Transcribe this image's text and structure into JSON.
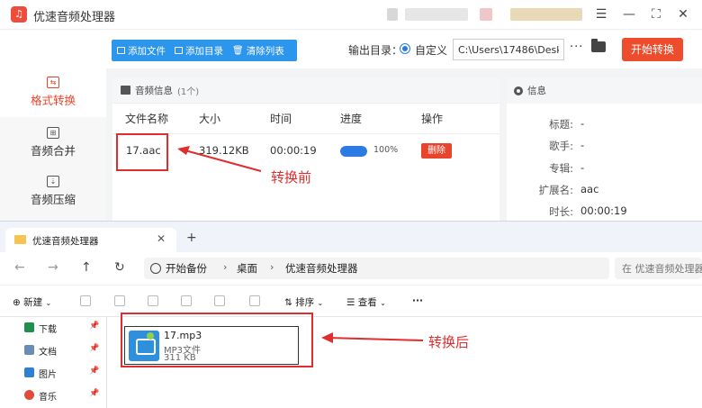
{
  "app": {
    "title": "优速音频处理器",
    "toolbar": {
      "add_file": "添加文件",
      "add_folder": "添加目录",
      "clear_list": "清除列表",
      "output_label": "输出目录：",
      "custom_label": "自定义",
      "output_path": "C:\\Users\\17486\\Deskto",
      "more": "···",
      "start": "开始转换"
    },
    "sidebar": [
      {
        "label": "格式转换",
        "icon": "convert-icon",
        "active": true
      },
      {
        "label": "音频合并",
        "icon": "merge-icon",
        "active": false
      },
      {
        "label": "音频压缩",
        "icon": "compress-icon",
        "active": false
      }
    ],
    "audio_panel": {
      "title": "音频信息",
      "count": "(1个)",
      "columns": {
        "name": "文件名称",
        "size": "大小",
        "time": "时间",
        "progress": "进度",
        "action": "操作"
      },
      "rows": [
        {
          "name": "17.aac",
          "size": "319.12KB",
          "time": "00:00:19",
          "progress": 1.0,
          "progress_text": "100%",
          "action": "删除"
        }
      ]
    },
    "info_panel": {
      "title": "信息",
      "rows": [
        {
          "key": "标题:",
          "value": "-"
        },
        {
          "key": "歌手:",
          "value": "-"
        },
        {
          "key": "专辑:",
          "value": "-"
        },
        {
          "key": "扩展名:",
          "value": "aac"
        },
        {
          "key": "时长:",
          "value": "00:00:19"
        }
      ]
    }
  },
  "explorer": {
    "tab_title": "优速音频处理器",
    "close": "✕",
    "new_tab": "+",
    "breadcrumbs": [
      "开始备份",
      "桌面",
      "优速音频处理器"
    ],
    "search_placeholder": "在 优速音频处理器",
    "commands": {
      "new": "新建",
      "sort": "排序",
      "view": "查看",
      "more": "···"
    },
    "nav_items": [
      {
        "label": "下载",
        "color": "#1f8f4e"
      },
      {
        "label": "文档",
        "color": "#6a8bb5"
      },
      {
        "label": "图片",
        "color": "#2f7fd4"
      },
      {
        "label": "音乐",
        "color": "#e04b3a"
      }
    ],
    "file": {
      "name": "17.mp3",
      "type": "MP3文件",
      "size": "311 KB"
    }
  },
  "annotations": {
    "before": "转换前",
    "after": "转换后"
  },
  "colors": {
    "accent": "#ee4d2d",
    "blue": "#2c95ec",
    "annotation": "#e02d2d"
  }
}
